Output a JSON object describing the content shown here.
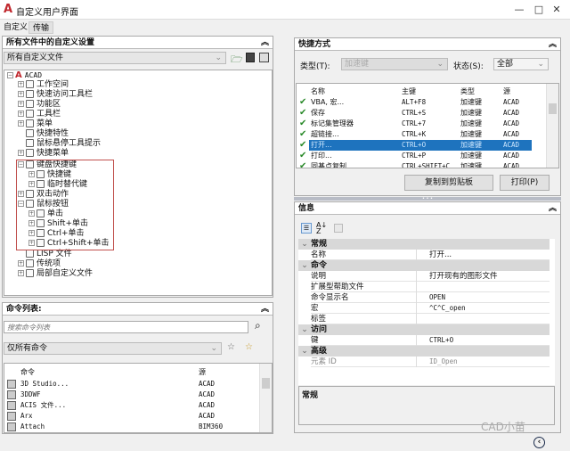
{
  "window": {
    "title": "自定义用户界面",
    "logo": "A",
    "close": "✕"
  },
  "tabs": [
    {
      "label": "自定义"
    },
    {
      "label": "传输"
    }
  ],
  "customize_panel": {
    "header": "所有文件中的自定义设置",
    "file_select": "所有自定义文件",
    "tree": [
      {
        "label": "ACAD"
      },
      {
        "label": "工作空间"
      },
      {
        "label": "快速访问工具栏"
      },
      {
        "label": "功能区"
      },
      {
        "label": "工具栏"
      },
      {
        "label": "菜单"
      },
      {
        "label": "快捷特性"
      },
      {
        "label": "鼠标悬停工具提示"
      },
      {
        "label": "快捷菜单"
      },
      {
        "label": "键盘快捷键"
      },
      {
        "label": "快捷键"
      },
      {
        "label": "临时替代键"
      },
      {
        "label": "双击动作"
      },
      {
        "label": "鼠标按钮"
      },
      {
        "label": "单击"
      },
      {
        "label": "Shift+单击"
      },
      {
        "label": "Ctrl+单击"
      },
      {
        "label": "Ctrl+Shift+单击"
      },
      {
        "label": "LISP 文件"
      },
      {
        "label": "传统项"
      },
      {
        "label": "局部自定义文件"
      }
    ]
  },
  "command_list": {
    "header": "命令列表:",
    "search_placeholder": "搜索命令列表",
    "filter": "仅所有命令",
    "columns": [
      "命令",
      "源"
    ],
    "rows": [
      [
        "3D Studio...",
        "ACAD"
      ],
      [
        "3DDWF",
        "ACAD"
      ],
      [
        "ACIS 文件...",
        "ACAD"
      ],
      [
        "Arx",
        "ACAD"
      ],
      [
        "Attach",
        "BIM360"
      ]
    ]
  },
  "shortcuts": {
    "header": "快捷方式",
    "type_label": "类型(T):",
    "type_value": "加速键",
    "status_label": "状态(S):",
    "status_value": "全部",
    "columns": [
      "名称",
      "主键",
      "类型",
      "源"
    ],
    "rows": [
      [
        "VBA, 宏...",
        "ALT+F8",
        "加速键",
        "ACAD"
      ],
      [
        "保存",
        "CTRL+S",
        "加速键",
        "ACAD"
      ],
      [
        "标记集管理器",
        "CTRL+7",
        "加速键",
        "ACAD"
      ],
      [
        "超链接...",
        "CTRL+K",
        "加速键",
        "ACAD"
      ],
      [
        "打开...",
        "CTRL+O",
        "加速键",
        "ACAD"
      ],
      [
        "打印...",
        "CTRL+P",
        "加速键",
        "ACAD"
      ],
      [
        "同基点复制",
        "CTRL+SHIFT+C",
        "加速键",
        "ACAD"
      ]
    ],
    "selected_row": 4,
    "copy_button": "复制到剪贴板",
    "print_button": "打印(P)"
  },
  "info": {
    "header": "信息",
    "categories": [
      {
        "name": "常规",
        "props": [
          [
            "名称",
            "打开..."
          ]
        ]
      },
      {
        "name": "命令",
        "props": [
          [
            "说明",
            "打开现有的图形文件"
          ],
          [
            "扩展型帮助文件",
            ""
          ],
          [
            "命令显示名",
            "OPEN"
          ],
          [
            "宏",
            "^C^C_open"
          ],
          [
            "标签",
            ""
          ]
        ]
      },
      {
        "name": "访问",
        "props": [
          [
            "键",
            "CTRL+O"
          ]
        ]
      },
      {
        "name": "高级",
        "props": [
          [
            "元素 ID",
            "ID_Open"
          ]
        ]
      }
    ],
    "description_title": "常规"
  },
  "watermark": "CAD小苗"
}
